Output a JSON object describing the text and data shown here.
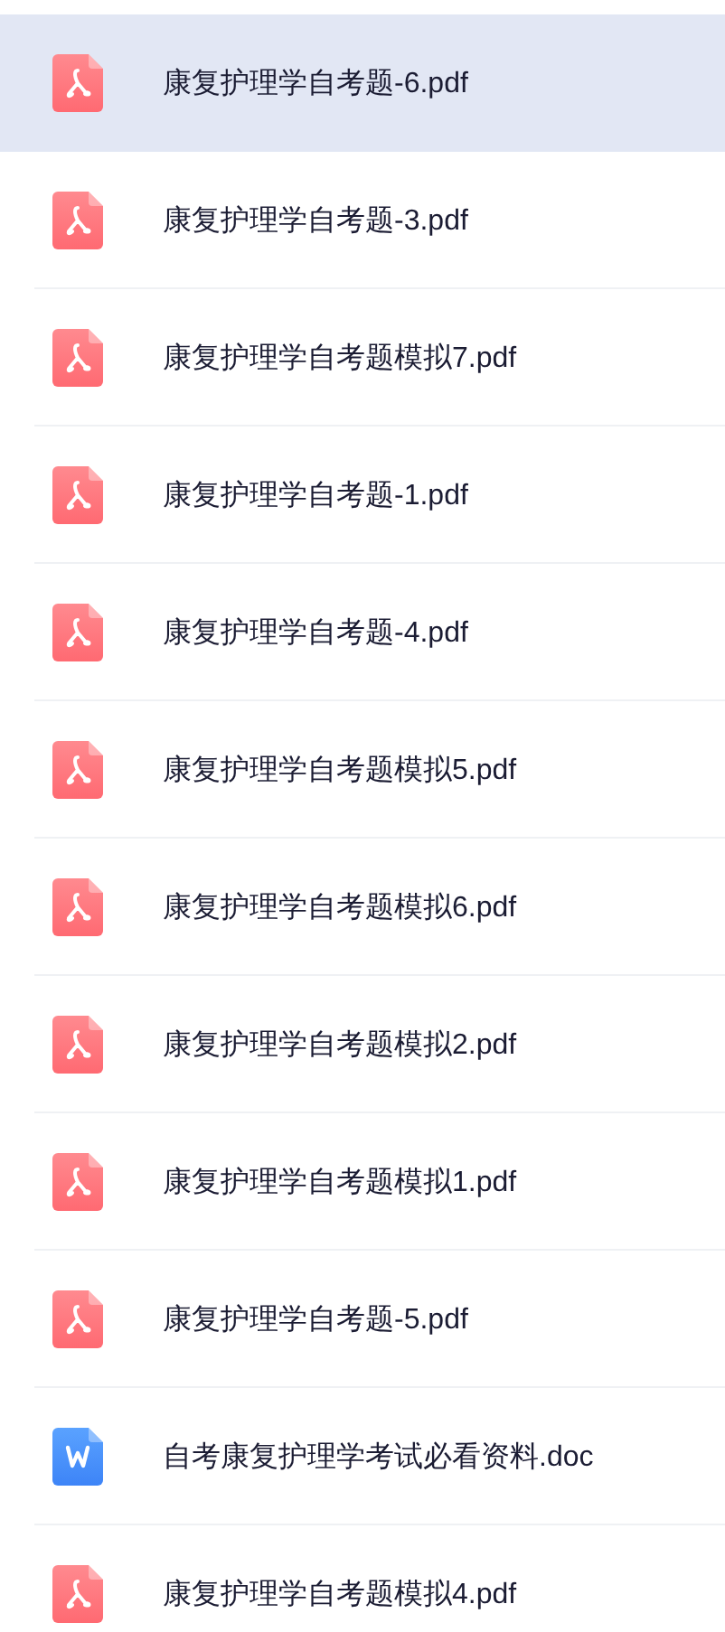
{
  "files": [
    {
      "name": "康复护理学自考题-6.pdf",
      "kind": "pdf",
      "selected": true
    },
    {
      "name": "康复护理学自考题-3.pdf",
      "kind": "pdf",
      "selected": false
    },
    {
      "name": "康复护理学自考题模拟7.pdf",
      "kind": "pdf",
      "selected": false
    },
    {
      "name": "康复护理学自考题-1.pdf",
      "kind": "pdf",
      "selected": false
    },
    {
      "name": "康复护理学自考题-4.pdf",
      "kind": "pdf",
      "selected": false
    },
    {
      "name": "康复护理学自考题模拟5.pdf",
      "kind": "pdf",
      "selected": false
    },
    {
      "name": "康复护理学自考题模拟6.pdf",
      "kind": "pdf",
      "selected": false
    },
    {
      "name": "康复护理学自考题模拟2.pdf",
      "kind": "pdf",
      "selected": false
    },
    {
      "name": "康复护理学自考题模拟1.pdf",
      "kind": "pdf",
      "selected": false
    },
    {
      "name": "康复护理学自考题-5.pdf",
      "kind": "pdf",
      "selected": false
    },
    {
      "name": "自考康复护理学考试必看资料.doc",
      "kind": "doc",
      "selected": false
    },
    {
      "name": "康复护理学自考题模拟4.pdf",
      "kind": "pdf",
      "selected": false
    }
  ]
}
